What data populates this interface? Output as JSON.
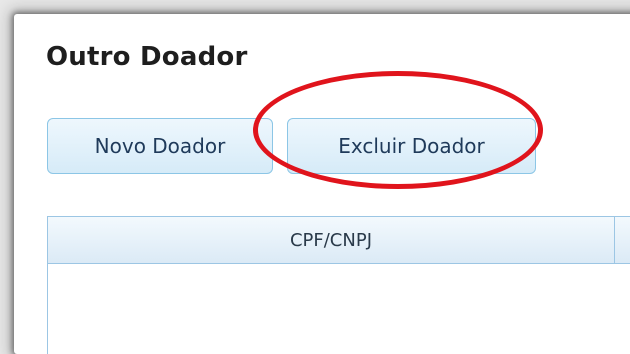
{
  "section": {
    "title": "Outro Doador"
  },
  "toolbar": {
    "new_donor_label": "Novo Doador",
    "delete_donor_label": "Excluir Doador"
  },
  "grid": {
    "columns": [
      "CPF/CNPJ",
      ""
    ],
    "rows": []
  },
  "colors": {
    "highlight_ring": "#e0141c",
    "button_border": "#8cc6e6",
    "button_text": "#1f3a5a",
    "grid_border": "#9cc6e4"
  }
}
